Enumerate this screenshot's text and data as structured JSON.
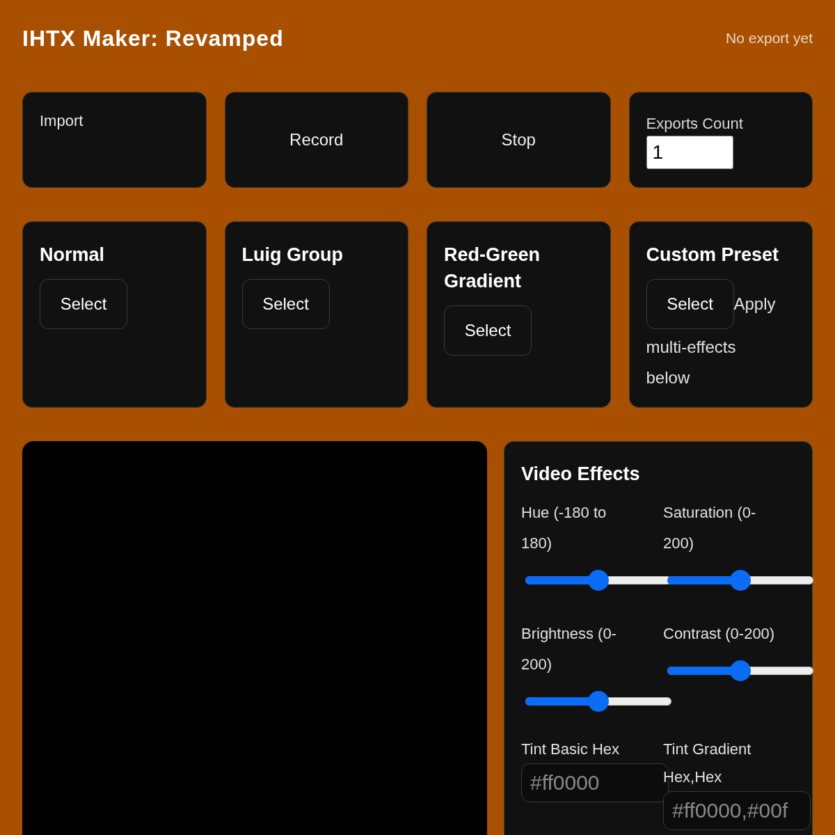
{
  "header": {
    "title": "IHTX Maker: Revamped",
    "status": "No export yet"
  },
  "controls": [
    {
      "kind": "import",
      "label": "Import"
    },
    {
      "kind": "button",
      "label": "Record"
    },
    {
      "kind": "button",
      "label": "Stop"
    },
    {
      "kind": "counter",
      "label": "Exports Count",
      "value": "1"
    }
  ],
  "presets": [
    {
      "name": "Normal",
      "button": "Select"
    },
    {
      "name": "Luig Group",
      "button": "Select"
    },
    {
      "name": "Red-Green Gradient",
      "button": "Select"
    },
    {
      "name": "Custom Preset",
      "button": "Select",
      "note": "Apply",
      "note_rest": "multi-effects below"
    }
  ],
  "effects": {
    "title": "Video Effects",
    "sliders": [
      {
        "label": "Hue (-180 to 180)",
        "level": 0.5
      },
      {
        "label": "Saturation (0-200)",
        "level": 0.5
      },
      {
        "label": "Brightness (0-200)",
        "level": 0.5
      },
      {
        "label": "Contrast (0-200)",
        "level": 0.5
      }
    ],
    "fields": [
      {
        "label": "Tint Basic Hex",
        "placeholder": "#ff0000"
      },
      {
        "label": "Tint Gradient Hex,Hex",
        "placeholder": "#ff0000,#00f"
      }
    ]
  }
}
